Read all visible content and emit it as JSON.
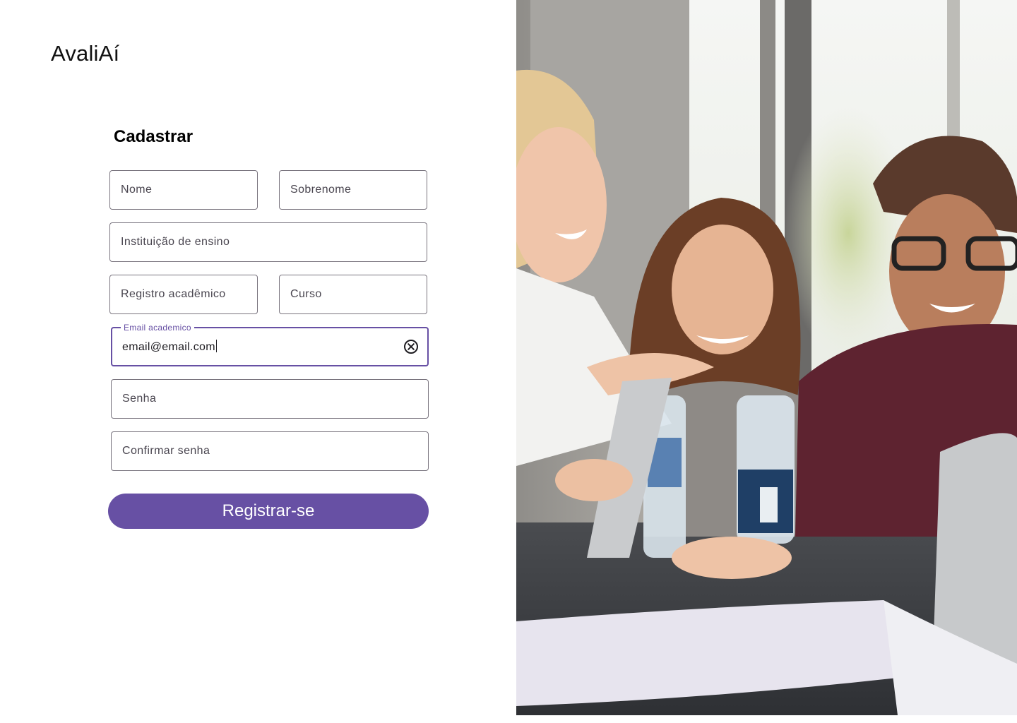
{
  "app": {
    "name": "AvaliAí"
  },
  "form": {
    "title": "Cadastrar",
    "fields": {
      "nome": {
        "placeholder": "Nome"
      },
      "sobrenome": {
        "placeholder": "Sobrenome"
      },
      "instituicao": {
        "placeholder": "Instituição de ensino"
      },
      "registro": {
        "placeholder": "Registro acadêmico"
      },
      "curso": {
        "placeholder": "Curso"
      },
      "email": {
        "label": "Email academico",
        "value": "email@email.com",
        "state": "focused"
      },
      "senha": {
        "placeholder": "Senha"
      },
      "confirmar_senha": {
        "placeholder": "Confirmar senha"
      }
    },
    "submit_label": "Registrar-se"
  },
  "icons": {
    "clear": "clear-circle-x-icon"
  },
  "colors": {
    "primary": "#6750a4",
    "outline": "#79747e",
    "text": "#1d1b20"
  }
}
